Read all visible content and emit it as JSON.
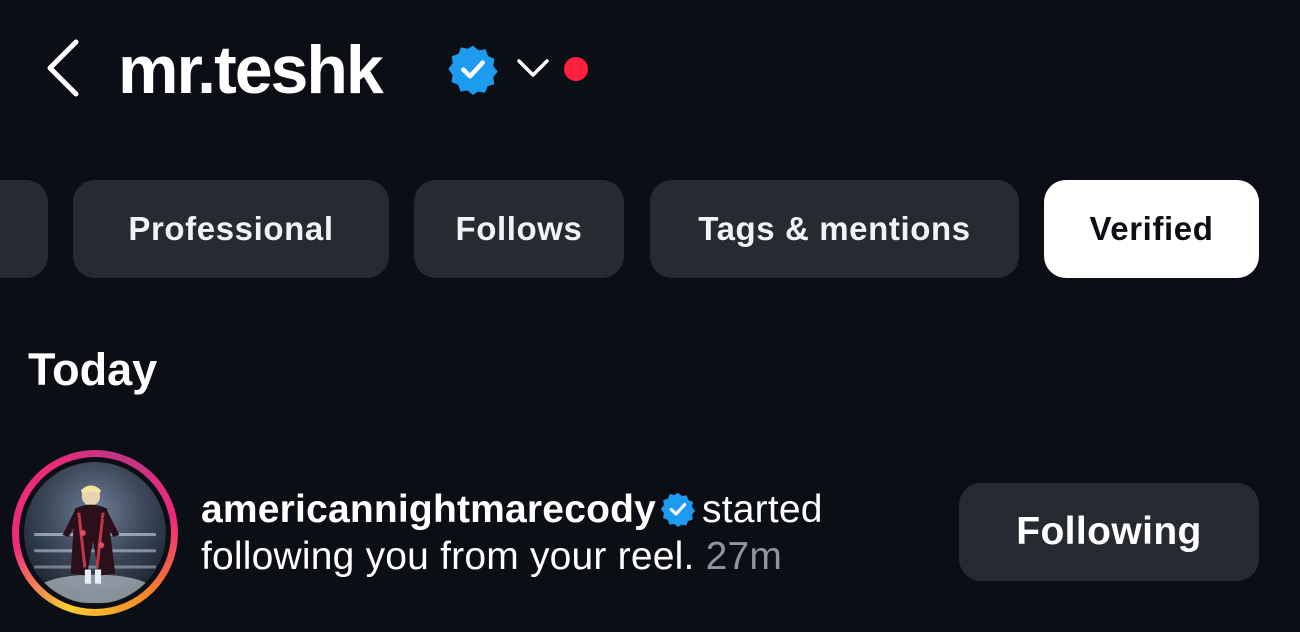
{
  "header": {
    "username": "mr.teshk",
    "icons": {
      "back": "chevron-left-icon",
      "verified": "verified-badge-icon",
      "switch": "chevron-down-icon",
      "dot": "notification-dot"
    },
    "colors": {
      "verified": "#1d9bf0",
      "dot": "#ff1f3d"
    }
  },
  "filters": {
    "partial_label": "",
    "items": [
      {
        "label": "Professional",
        "active": false
      },
      {
        "label": "Follows",
        "active": false
      },
      {
        "label": "Tags & mentions",
        "active": false
      },
      {
        "label": "Verified",
        "active": true
      }
    ]
  },
  "section": {
    "title": "Today"
  },
  "notification": {
    "username": "americannightmarecody",
    "text_after_user": "started following you from your reel.",
    "time": "27m",
    "button_label": "Following",
    "verified": true
  }
}
